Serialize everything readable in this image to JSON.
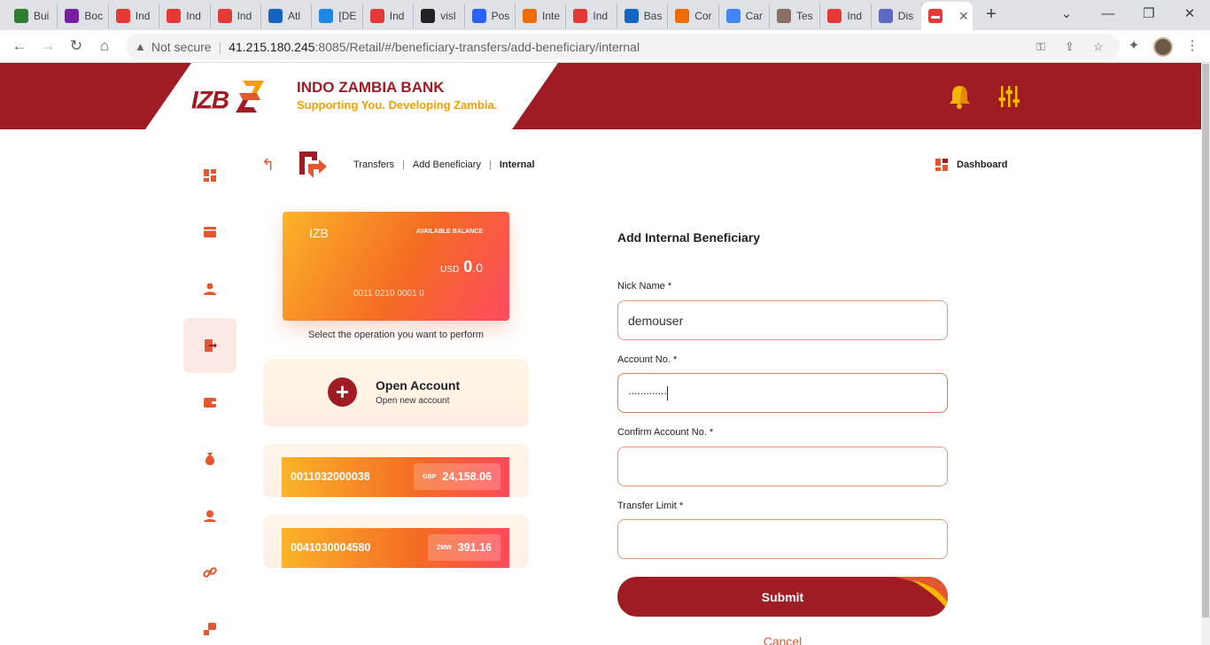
{
  "browser": {
    "tabs": [
      {
        "label": "Bui",
        "favicon_color": "#2e7d32"
      },
      {
        "label": "Boc",
        "favicon_color": "#7b1fa2"
      },
      {
        "label": "Ind",
        "favicon_color": "#e53935"
      },
      {
        "label": "Ind",
        "favicon_color": "#e53935"
      },
      {
        "label": "Ind",
        "favicon_color": "#e53935"
      },
      {
        "label": "Atl",
        "favicon_color": "#1565c0"
      },
      {
        "label": "[DE",
        "favicon_color": "#1e88e5"
      },
      {
        "label": "Ind",
        "favicon_color": "#e53935"
      },
      {
        "label": "visl",
        "favicon_color": "#222222"
      },
      {
        "label": "Pos",
        "favicon_color": "#2962ff"
      },
      {
        "label": "Inte",
        "favicon_color": "#ef6c00"
      },
      {
        "label": "Ind",
        "favicon_color": "#e53935"
      },
      {
        "label": "Bas",
        "favicon_color": "#1565c0"
      },
      {
        "label": "Cor",
        "favicon_color": "#ef6c00"
      },
      {
        "label": "Car",
        "favicon_color": "#4285f4"
      },
      {
        "label": "Tes",
        "favicon_color": "#8d6e63"
      },
      {
        "label": "Ind",
        "favicon_color": "#e53935"
      },
      {
        "label": "Dis",
        "favicon_color": "#5c6bc0"
      }
    ],
    "active_tab_close": "✕",
    "new_tab": "+",
    "security_label": "Not secure",
    "url_host": "41.215.180.245",
    "url_rest": ":8085/Retail/#/beneficiary-transfers/add-beneficiary/internal"
  },
  "header": {
    "logo": "IZB",
    "logo_sub": "INDO ZAMBIA BANK",
    "bank_name": "INDO ZAMBIA BANK",
    "tagline": "Supporting You. Developing Zambia.",
    "brand_red": "#a01c24",
    "brand_gold": "#f0a000"
  },
  "breadcrumb": {
    "items": [
      "Transfers",
      "Add Beneficiary",
      "Internal"
    ],
    "dashboard_link": "Dashboard"
  },
  "card": {
    "brand": "IZB",
    "available_label": "AVAILABLE BALANCE",
    "currency": "USD",
    "balance_whole": "0",
    "balance_dec": ".0",
    "account": "0011 0210 0001 0"
  },
  "operations": {
    "prompt": "Select the operation you want to perform",
    "open_account_title": "Open Account",
    "open_account_sub": "Open new account"
  },
  "accounts": [
    {
      "number": "0011032000038",
      "currency": "GBP",
      "balance": "24,158.06"
    },
    {
      "number": "0041030004580",
      "currency": "ZMW",
      "balance": "391.16"
    }
  ],
  "form": {
    "title": "Add Internal Beneficiary",
    "nick_label": "Nick Name *",
    "nick_value": "demouser",
    "acct_label": "Account No. *",
    "acct_value": "·············",
    "confirm_label": "Confirm Account No. *",
    "confirm_value": "",
    "limit_label": "Transfer Limit *",
    "limit_value": "",
    "submit": "Submit",
    "cancel": "Cancel"
  }
}
